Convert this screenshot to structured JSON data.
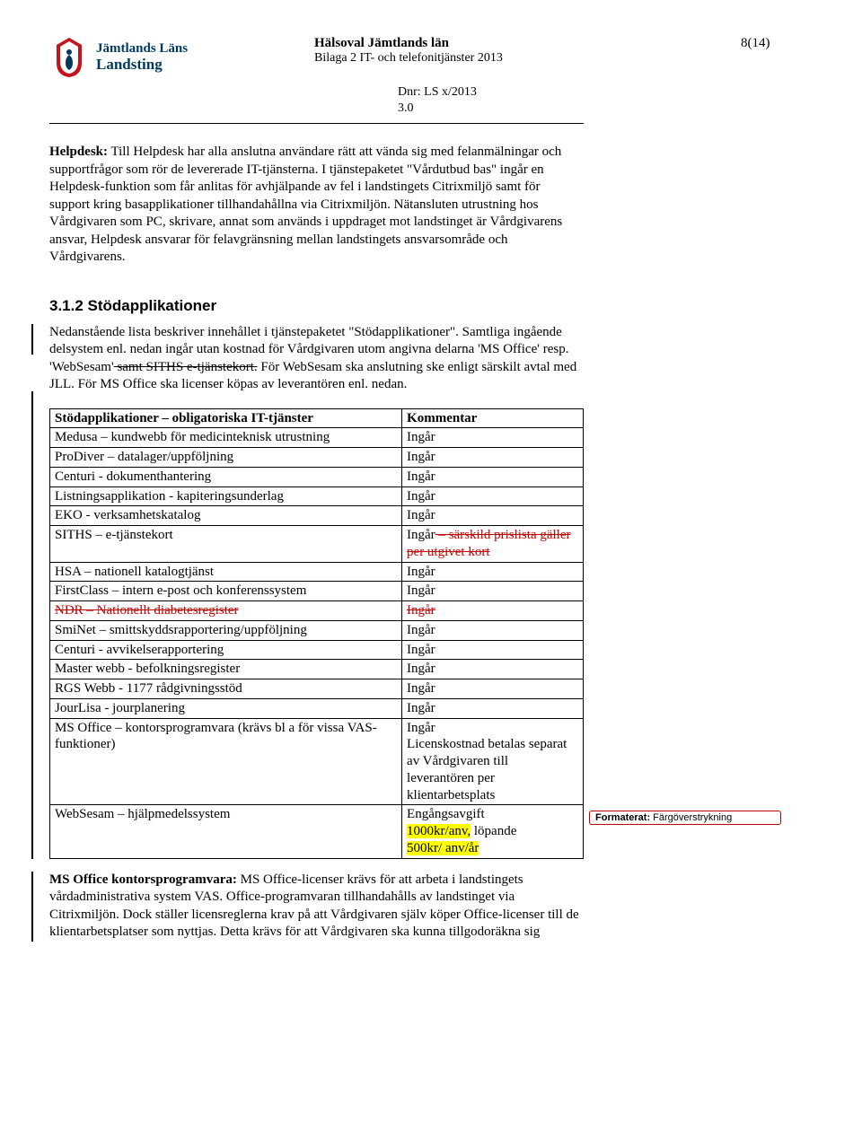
{
  "logo": {
    "line1": "Jämtlands Läns",
    "line2": "Landsting"
  },
  "header": {
    "title": "Hälsoval Jämtlands län",
    "subtitle": "Bilaga 2 IT- och telefonitjänster 2013",
    "page": "8(14)",
    "dnr1": "Dnr:  LS x/2013",
    "dnr2": "3.0"
  },
  "para1_lead": "Helpdesk:",
  "para1_rest": " Till Helpdesk har alla anslutna användare rätt att vända sig med felanmälningar och supportfrågor som rör de levererade IT-tjänsterna. I tjänstepaketet \"Vårdutbud bas\" ingår en Helpdesk-funktion som får anlitas för avhjälpande av fel i landstingets Citrixmiljö samt för support kring basapplikationer tillhandahållna via Citrixmiljön. Nätansluten utrustning hos Vårdgivaren som PC, skrivare, annat som används i uppdraget mot landstinget är Vårdgivarens ansvar, Helpdesk ansvarar för felavgränsning mellan landstingets ansvarsområde och Vårdgivarens.",
  "section_heading": "3.1.2 Stödapplikationer",
  "para2a": "Nedanstående lista beskriver innehållet i tjänstepaketet \"Stödapplikationer\". Samtliga ingående delsystem enl. nedan ingår utan kostnad för Vårdgivaren utom angivna delarna 'MS Office' resp. 'WebSesam'",
  "para2_strike": " samt SITHS e-tjänstekort.",
  "para2b": " För WebSesam ska anslutning ske enligt särskilt avtal med JLL. För MS Office ska licenser köpas av leverantören enl. nedan.",
  "table_head_left": "Stödapplikationer – obligatoriska IT-tjänster",
  "table_head_right": "Kommentar",
  "rows": [
    {
      "l": "Medusa – kundwebb för medicinteknisk utrustning",
      "r": "Ingår"
    },
    {
      "l": "ProDiver – datalager/uppföljning",
      "r": "Ingår"
    },
    {
      "l": "Centuri - dokumenthantering",
      "r": "Ingår"
    },
    {
      "l": "Listningsapplikation - kapiteringsunderlag",
      "r": "Ingår"
    },
    {
      "l": "EKO - verksamhetskatalog",
      "r": "Ingår"
    }
  ],
  "row_siths_l": "SITHS – e-tjänstekort",
  "row_siths_r1": "Ingår",
  "row_siths_r_strike": " – särskild prislista gäller per utgivet kort",
  "rows2": [
    {
      "l": "HSA – nationell katalogtjänst",
      "r": "Ingår"
    },
    {
      "l": "FirstClass – intern e-post och konferenssystem",
      "r": "Ingår"
    }
  ],
  "row_ndr_l": "NDR – Nationellt diabetesregister",
  "row_ndr_r": "Ingår",
  "rows3": [
    {
      "l": "SmiNet – smittskyddsrapportering/uppföljning",
      "r": "Ingår"
    },
    {
      "l": "Centuri - avvikelserapportering",
      "r": "Ingår"
    },
    {
      "l": "Master webb - befolkningsregister",
      "r": "Ingår"
    },
    {
      "l": "RGS Webb - 1177 rådgivningsstöd",
      "r": "Ingår"
    },
    {
      "l": "JourLisa - jourplanering",
      "r": "Ingår"
    }
  ],
  "row_ms_l": "MS Office – kontorsprogramvara (krävs bl a för vissa VAS-funktioner)",
  "row_ms_r": "Ingår\nLicenskostnad betalas separat av Vårdgivaren till leverantören per klientarbetsplats",
  "row_ws_l": "WebSesam – hjälpmedelssystem",
  "row_ws_r1": "Engångsavgift",
  "row_ws_hl1": "1000kr/anv,",
  "row_ws_r2": " löpande ",
  "row_ws_hl2": "500kr/ anv/år",
  "callout_lead": "Formaterat:",
  "callout_rest": " Färgöverstrykning",
  "para3_lead": "MS Office kontorsprogramvara:",
  "para3_rest": " MS Office-licenser krävs för att arbeta i landstingets vårdadministrativa system VAS. Office-programvaran tillhandahålls av landstinget via Citrixmiljön. Dock ställer licensreglerna krav på att Vårdgivaren själv köper Office-licenser till de klientarbetsplatser som nyttjas. Detta krävs för att Vårdgivaren ska kunna tillgodoräkna sig"
}
